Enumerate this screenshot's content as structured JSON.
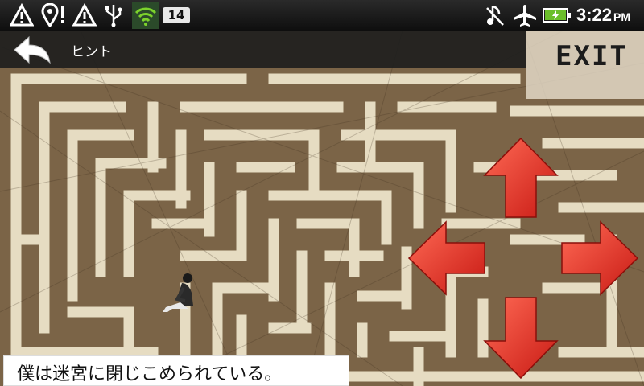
{
  "status_bar": {
    "notification_icons": [
      "warning-icon",
      "location-alert-icon",
      "warning-icon",
      "usb-icon",
      "wifi-icon"
    ],
    "badge_count": "14",
    "right_icons": [
      "music-muted-icon",
      "airplane-icon",
      "battery-charging-icon"
    ],
    "time": "3:22",
    "ampm": "PM"
  },
  "header": {
    "back_icon": "back-arrow-icon",
    "title": "ヒント"
  },
  "exit": {
    "label": "EXIT"
  },
  "dpad": {
    "up_icon": "arrow-up-icon",
    "down_icon": "arrow-down-icon",
    "left_icon": "arrow-left-icon",
    "right_icon": "arrow-right-icon",
    "color": "#e8302a"
  },
  "message": {
    "text": "僕は迷宮に閉じこめられている。"
  },
  "colors": {
    "maze_wall": "#e8e0c8",
    "maze_path": "#7a6448",
    "status_bg": "#111111"
  }
}
